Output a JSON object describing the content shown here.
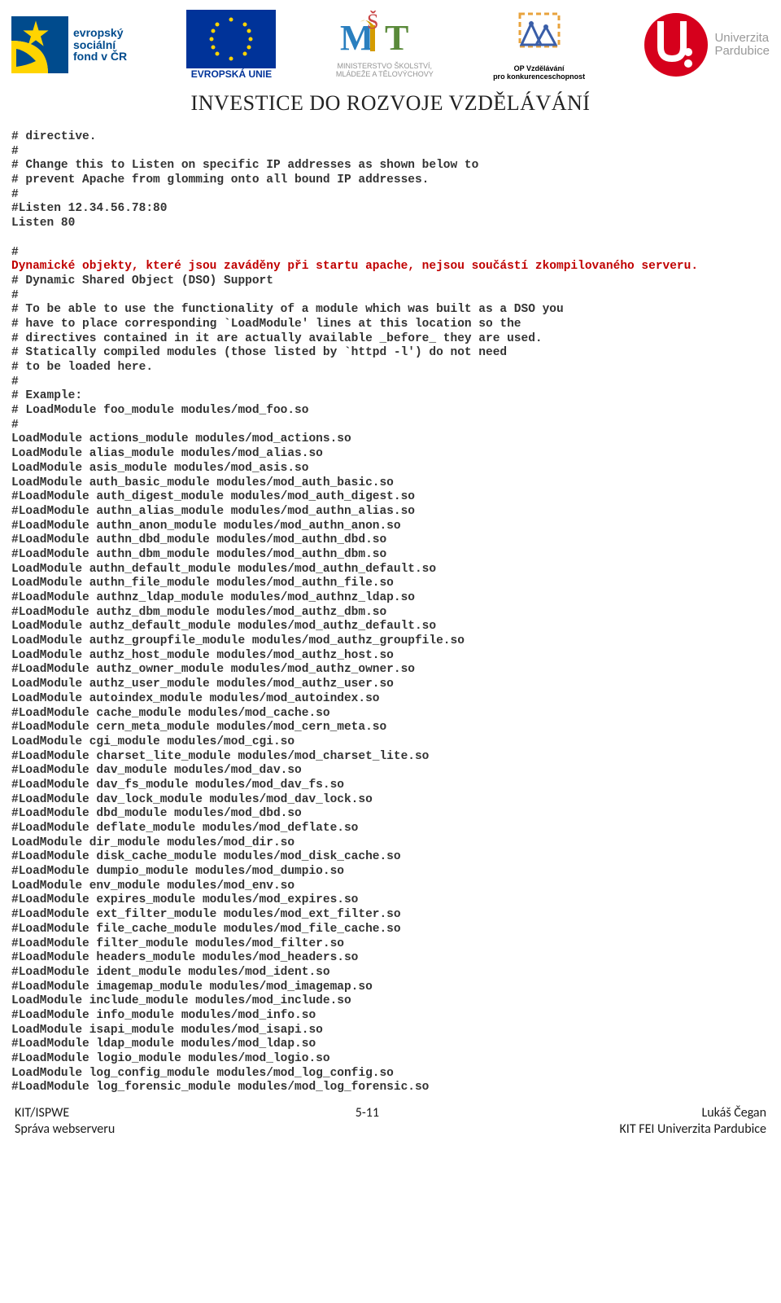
{
  "header": {
    "esf_line1": "evropský",
    "esf_line2": "sociální",
    "esf_line3": "fond v ČR",
    "eu_label": "EVROPSKÁ UNIE",
    "msmt_line1": "MINISTERSTVO ŠKOLSTVÍ,",
    "msmt_line2": "MLÁDEŽE A TĚLOVÝCHOVY",
    "op_line1": "OP Vzdělávání",
    "op_line2": "pro konkurenceschopnost",
    "upce_line1": "Univerzita",
    "upce_line2": "Pardubice",
    "banner": "INVESTICE DO ROZVOJE VZDĚLÁVÁNÍ"
  },
  "code": {
    "block1": "# directive.\n#\n# Change this to Listen on specific IP addresses as shown below to\n# prevent Apache from glomming onto all bound IP addresses.\n#\n#Listen 12.34.56.78:80\nListen 80\n\n#",
    "red1": "Dynamické objekty, které jsou zaváděny při startu apache, nejsou součástí zkompilovaného serveru.",
    "block2": "# Dynamic Shared Object (DSO) Support\n#\n# To be able to use the functionality of a module which was built as a DSO you\n# have to place corresponding `LoadModule' lines at this location so the\n# directives contained in it are actually available _before_ they are used.\n# Statically compiled modules (those listed by `httpd -l') do not need\n# to be loaded here.\n#\n# Example:\n# LoadModule foo_module modules/mod_foo.so\n#\nLoadModule actions_module modules/mod_actions.so\nLoadModule alias_module modules/mod_alias.so\nLoadModule asis_module modules/mod_asis.so\nLoadModule auth_basic_module modules/mod_auth_basic.so\n#LoadModule auth_digest_module modules/mod_auth_digest.so\n#LoadModule authn_alias_module modules/mod_authn_alias.so\n#LoadModule authn_anon_module modules/mod_authn_anon.so\n#LoadModule authn_dbd_module modules/mod_authn_dbd.so\n#LoadModule authn_dbm_module modules/mod_authn_dbm.so\nLoadModule authn_default_module modules/mod_authn_default.so\nLoadModule authn_file_module modules/mod_authn_file.so\n#LoadModule authnz_ldap_module modules/mod_authnz_ldap.so\n#LoadModule authz_dbm_module modules/mod_authz_dbm.so\nLoadModule authz_default_module modules/mod_authz_default.so\nLoadModule authz_groupfile_module modules/mod_authz_groupfile.so\nLoadModule authz_host_module modules/mod_authz_host.so\n#LoadModule authz_owner_module modules/mod_authz_owner.so\nLoadModule authz_user_module modules/mod_authz_user.so\nLoadModule autoindex_module modules/mod_autoindex.so\n#LoadModule cache_module modules/mod_cache.so\n#LoadModule cern_meta_module modules/mod_cern_meta.so\nLoadModule cgi_module modules/mod_cgi.so\n#LoadModule charset_lite_module modules/mod_charset_lite.so\n#LoadModule dav_module modules/mod_dav.so\n#LoadModule dav_fs_module modules/mod_dav_fs.so\n#LoadModule dav_lock_module modules/mod_dav_lock.so\n#LoadModule dbd_module modules/mod_dbd.so\n#LoadModule deflate_module modules/mod_deflate.so\nLoadModule dir_module modules/mod_dir.so\n#LoadModule disk_cache_module modules/mod_disk_cache.so\n#LoadModule dumpio_module modules/mod_dumpio.so\nLoadModule env_module modules/mod_env.so\n#LoadModule expires_module modules/mod_expires.so\n#LoadModule ext_filter_module modules/mod_ext_filter.so\n#LoadModule file_cache_module modules/mod_file_cache.so\n#LoadModule filter_module modules/mod_filter.so\n#LoadModule headers_module modules/mod_headers.so\n#LoadModule ident_module modules/mod_ident.so\n#LoadModule imagemap_module modules/mod_imagemap.so\nLoadModule include_module modules/mod_include.so\n#LoadModule info_module modules/mod_info.so\nLoadModule isapi_module modules/mod_isapi.so\n#LoadModule ldap_module modules/mod_ldap.so\n#LoadModule logio_module modules/mod_logio.so\nLoadModule log_config_module modules/mod_log_config.so\n#LoadModule log_forensic_module modules/mod_log_forensic.so"
  },
  "footer": {
    "left1": "KIT/ISPWE",
    "left2": "Správa webserveru",
    "center": "5-11",
    "right1": "Lukáš Čegan",
    "right2": "KIT FEI Univerzita Pardubice"
  }
}
